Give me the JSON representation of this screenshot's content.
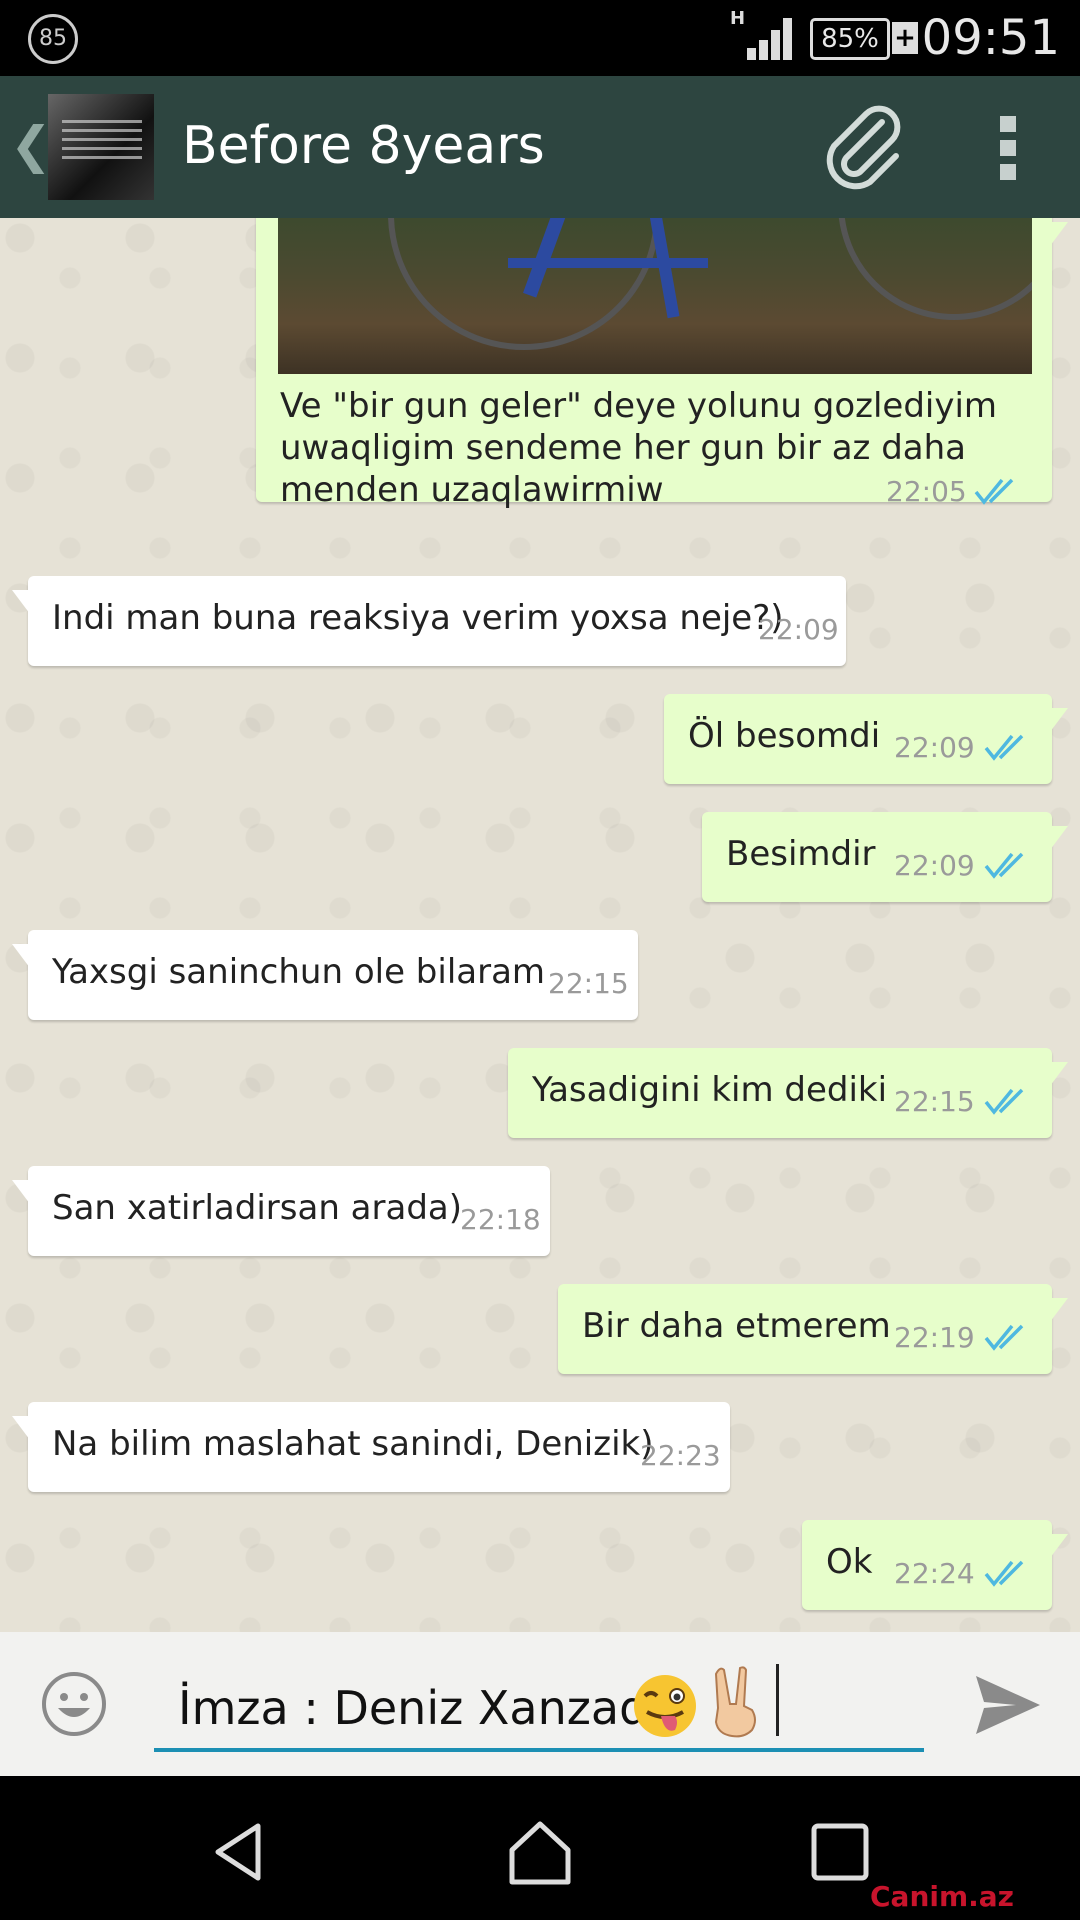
{
  "status_bar": {
    "notification_badge": "85",
    "network_type": "H",
    "battery": "85%",
    "charging_symbol": "+",
    "time": "09:51"
  },
  "header": {
    "title": "Before 8years"
  },
  "messages": [
    {
      "direction": "out",
      "text_lines": [
        "Ve \"bir gun geler\" deye yolunu gozlediyim",
        "uwaqligim sendeme her gun bir az daha",
        "menden uzaqlawirmiw"
      ],
      "time": "22:05",
      "has_image": true
    },
    {
      "direction": "in",
      "text": "Indi man buna reaksiya verim yoxsa neje?)",
      "time": "22:09"
    },
    {
      "direction": "out",
      "text": "Öl besomdi",
      "time": "22:09"
    },
    {
      "direction": "out",
      "text": "Besimdir",
      "time": "22:09"
    },
    {
      "direction": "in",
      "text": "Yaxsgi saninchun ole bilaram",
      "time": "22:15"
    },
    {
      "direction": "out",
      "text": "Yasadigini kim dediki",
      "time": "22:15"
    },
    {
      "direction": "in",
      "text": "San xatirladirsan arada)",
      "time": "22:18"
    },
    {
      "direction": "out",
      "text": "Bir daha etmerem",
      "time": "22:19"
    },
    {
      "direction": "in",
      "text": "Na bilim maslahat sanindi, Denizik)",
      "time": "22:23"
    },
    {
      "direction": "out",
      "text": "Ok",
      "time": "22:24"
    }
  ],
  "input": {
    "value": "İmza : Deniz Xanzade",
    "emojis": [
      "winking-tongue-emoji",
      "peace-hand-emoji"
    ]
  },
  "watermark": "Canim.az",
  "colors": {
    "header_bg": "#2d4540",
    "outgoing_bubble": "#e7fecb",
    "incoming_bubble": "#ffffff",
    "read_ticks": "#4fb8e0",
    "input_underline": "#1c8fb3"
  },
  "icons": [
    "back-chevron-icon",
    "attach-paperclip-icon",
    "overflow-menu-icon",
    "emoji-smiley-icon",
    "send-icon",
    "nav-back-icon",
    "nav-home-icon",
    "nav-recents-icon"
  ]
}
